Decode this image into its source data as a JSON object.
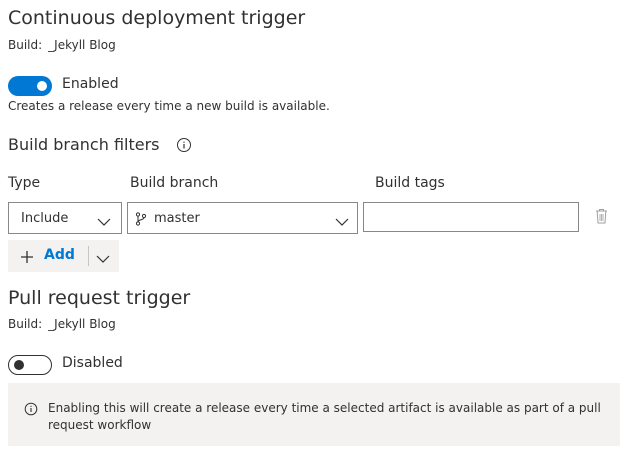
{
  "cd_trigger": {
    "title": "Continuous deployment trigger",
    "build_label": "Build:",
    "build_name": "_Jekyll Blog",
    "toggle_label": "Enabled",
    "description": "Creates a release every time a new build is available."
  },
  "branch_filters": {
    "title": "Build branch filters",
    "columns": {
      "type": "Type",
      "branch": "Build branch",
      "tags": "Build tags"
    },
    "row": {
      "type_value": "Include",
      "branch_value": "master",
      "tags_value": ""
    },
    "add_label": "Add"
  },
  "pr_trigger": {
    "title": "Pull request trigger",
    "build_label": "Build:",
    "build_name": "_Jekyll Blog",
    "toggle_label": "Disabled",
    "info_text": "Enabling this will create a release every time a selected artifact is available as part of a pull request workflow"
  },
  "colors": {
    "accent": "#0078d4",
    "text": "#323130",
    "border": "#8a8886",
    "panel_bg": "#f3f2f1"
  },
  "icons": [
    "info-icon",
    "branch-icon",
    "chevron-down-icon",
    "trash-icon",
    "plus-icon"
  ]
}
